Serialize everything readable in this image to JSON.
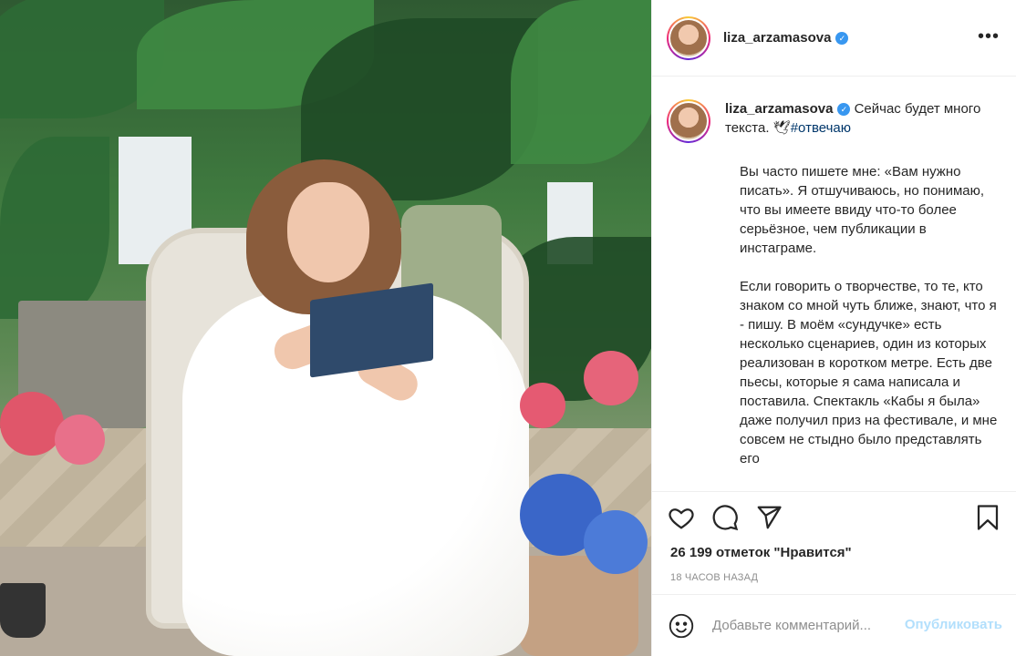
{
  "post": {
    "username": "liza_arzamasova",
    "more_icon": "more-horizontal-icon",
    "verified_icon": "verified-badge-icon"
  },
  "caption": {
    "username": "liza_arzamasova",
    "text": "Сейчас будет много текста.",
    "emoji": "🕊",
    "hashtag": "#отвечаю"
  },
  "body": {
    "paragraphs": [
      "Вы часто пишете мне: «Вам нужно писать». Я отшучиваюсь, но понимаю, что вы имеете ввиду что-то более серьёзное, чем публикации в инстаграме.",
      "Если говорить о творчестве, то те, кто знаком со мной чуть ближе, знают, что я - пишу. В моём «сундучке» есть несколько сценариев, один из которых реализован в коротком метре. Есть две пьесы, которые я сама написала и поставила. Спектакль «Кабы я была» даже получил приз на фестивале, и мне совсем не стыдно было представлять его"
    ]
  },
  "actions": {
    "icons": [
      "heart-icon",
      "comment-icon",
      "share-icon",
      "bookmark-icon"
    ]
  },
  "likes": "26 199 отметок \"Нравится\"",
  "timestamp": "18 ЧАСОВ НАЗАД",
  "comment_box": {
    "placeholder": "Добавьте комментарий...",
    "publish_label": "Опубликовать",
    "emoji_icon": "smiley-icon"
  },
  "colors": {
    "text": "#262626",
    "secondary": "#8e8e8e",
    "link": "#00376b",
    "publish_disabled": "#b2dffc",
    "verified": "#3897f0"
  }
}
